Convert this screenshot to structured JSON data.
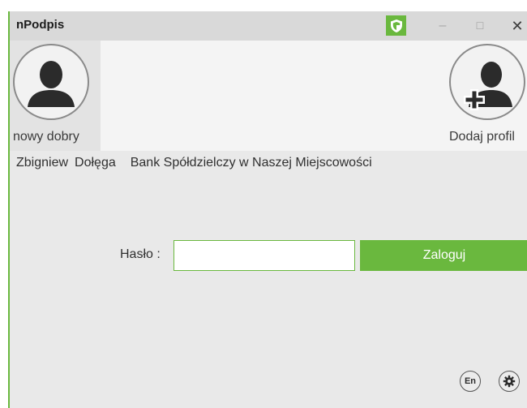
{
  "window": {
    "title": "nPodpis",
    "accent_color": "#6ab83e",
    "controls": {
      "shield": "shield-icon",
      "minimize": "minimize-icon",
      "maximize": "maximize-icon",
      "close": "close-icon"
    }
  },
  "profiles": [
    {
      "name": "nowy dobry",
      "icon": "user-avatar-icon",
      "selected": true
    },
    {
      "name": "Dodaj profil",
      "icon": "add-user-icon",
      "selected": false
    }
  ],
  "user": {
    "first_name": "Zbigniew",
    "last_name": "Dołęga",
    "bank": "Bank Spółdzielczy w Naszej Miejscowości"
  },
  "login": {
    "password_label": "Hasło :",
    "password_value": "",
    "button_label": "Zaloguj"
  },
  "footer": {
    "language_label": "En",
    "settings_icon": "gear-icon"
  }
}
